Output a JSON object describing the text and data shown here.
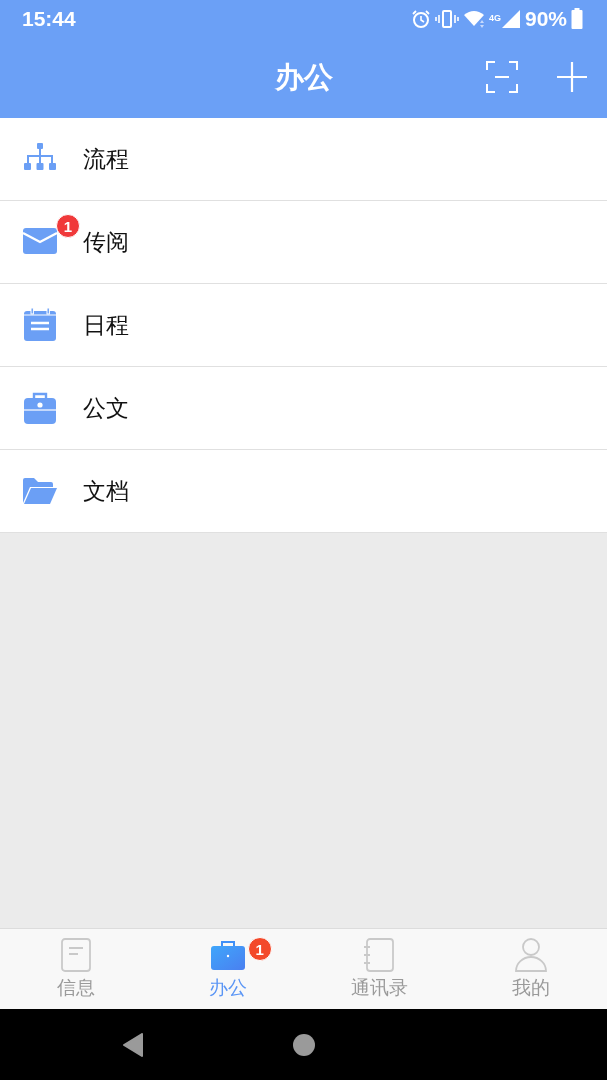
{
  "status_bar": {
    "time": "15:44",
    "network": "4G",
    "battery": "90%"
  },
  "header": {
    "title": "办公"
  },
  "items": [
    {
      "label": "流程",
      "kind": "flow"
    },
    {
      "label": "传阅",
      "kind": "mail",
      "badge": "1"
    },
    {
      "label": "日程",
      "kind": "calendar"
    },
    {
      "label": "公文",
      "kind": "briefcase"
    },
    {
      "label": "文档",
      "kind": "folder"
    }
  ],
  "tabs": [
    {
      "label": "信息",
      "kind": "note",
      "selected": false
    },
    {
      "label": "办公",
      "kind": "briefcase",
      "selected": true,
      "badge": "1"
    },
    {
      "label": "通讯录",
      "kind": "book",
      "selected": false
    },
    {
      "label": "我的",
      "kind": "person",
      "selected": false
    }
  ]
}
